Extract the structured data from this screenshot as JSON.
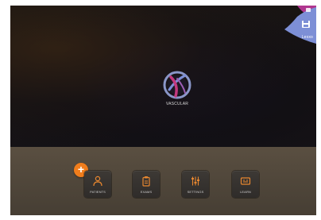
{
  "corner": {
    "label": "Lexxo",
    "icon": "save-icon"
  },
  "center_app": {
    "label": "VASCULAR",
    "icon": "vascular-logo-icon"
  },
  "dock": {
    "add_label": "+",
    "items": [
      {
        "label": "PATIENTS",
        "icon": "patient-icon"
      },
      {
        "label": "EXAMS",
        "icon": "clipboard-icon"
      },
      {
        "label": "SETTINGS",
        "icon": "sliders-icon"
      },
      {
        "label": "LEARN",
        "icon": "learn-icon"
      }
    ]
  },
  "colors": {
    "accent": "#f07d1c",
    "corner_primary": "#7d8fd6",
    "corner_secondary": "#b0368f",
    "dock": "#53493d",
    "icon_orange": "#e8872f"
  }
}
